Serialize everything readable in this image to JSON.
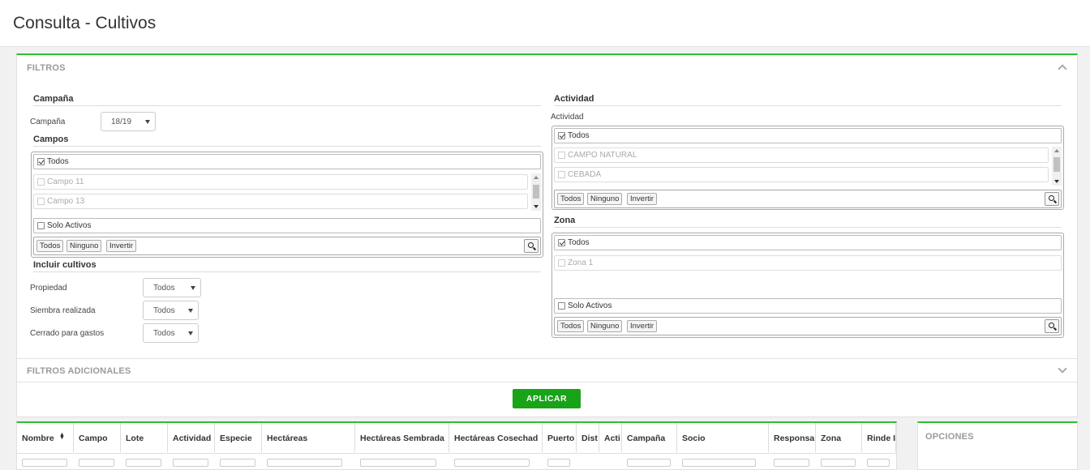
{
  "page": {
    "title": "Consulta - Cultivos"
  },
  "filtros": {
    "header": "FILTROS",
    "campana_section": "Campaña",
    "campana_label": "Campaña",
    "campana_value": "18/19",
    "campos_section": "Campos",
    "campos_items": [
      {
        "label": "Todos",
        "checked": true
      },
      {
        "label": "Campo 11",
        "checked": false
      },
      {
        "label": "Campo 13",
        "checked": false
      }
    ],
    "solo_activos": "Solo Activos",
    "btn_todos": "Todos",
    "btn_ninguno": "Ninguno",
    "btn_invertir": "Invertir",
    "incluir_section": "Incluir cultivos",
    "propiedad_label": "Propiedad",
    "propiedad_value": "Todos",
    "siembra_label": "Siembra realizada",
    "siembra_value": "Todos",
    "cerrado_label": "Cerrado para gastos",
    "cerrado_value": "Todos",
    "actividad_section": "Actividad",
    "actividad_label": "Actividad",
    "actividad_items": [
      {
        "label": "Todos",
        "checked": true
      },
      {
        "label": "CAMPO NATURAL",
        "checked": false
      },
      {
        "label": "CEBADA",
        "checked": false
      }
    ],
    "zona_section": "Zona",
    "zona_items": [
      {
        "label": "Todos",
        "checked": true
      },
      {
        "label": "Zona 1",
        "checked": false
      }
    ]
  },
  "filtros_adicionales": {
    "header": "FILTROS ADICIONALES"
  },
  "apply_label": "APLICAR",
  "table": {
    "columns": [
      "Nombre",
      "Campo",
      "Lote",
      "Actividad",
      "Especie",
      "Hectáreas",
      "Hectáreas Sembrada",
      "Hectáreas Cosechad",
      "Puerto",
      "Dist",
      "Acti",
      "Campaña",
      "Socio",
      "Responsa",
      "Zona",
      "Rinde I"
    ]
  },
  "opciones": {
    "header": "OPCIONES"
  },
  "colors": {
    "accent": "#2ec12e",
    "apply_button": "#19a319"
  }
}
